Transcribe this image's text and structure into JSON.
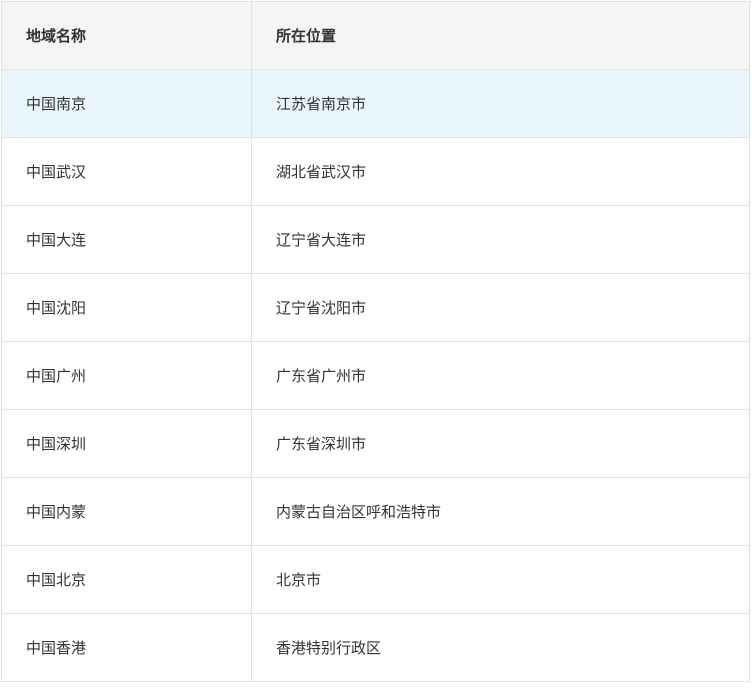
{
  "table": {
    "headers": [
      "地域名称",
      "所在位置"
    ],
    "rows": [
      {
        "region": "中国南京",
        "location": "江苏省南京市"
      },
      {
        "region": "中国武汉",
        "location": "湖北省武汉市"
      },
      {
        "region": "中国大连",
        "location": "辽宁省大连市"
      },
      {
        "region": "中国沈阳",
        "location": "辽宁省沈阳市"
      },
      {
        "region": "中国广州",
        "location": "广东省广州市"
      },
      {
        "region": "中国深圳",
        "location": "广东省深圳市"
      },
      {
        "region": "中国内蒙",
        "location": "内蒙古自治区呼和浩特市"
      },
      {
        "region": "中国北京",
        "location": "北京市"
      },
      {
        "region": "中国香港",
        "location": "香港特别行政区"
      }
    ],
    "highlighted_row_index": 0
  },
  "colors": {
    "header_background": "#f5f5f5",
    "highlight_background": "#eaf6fe",
    "border": "#e1e1e1",
    "text": "#333333"
  }
}
